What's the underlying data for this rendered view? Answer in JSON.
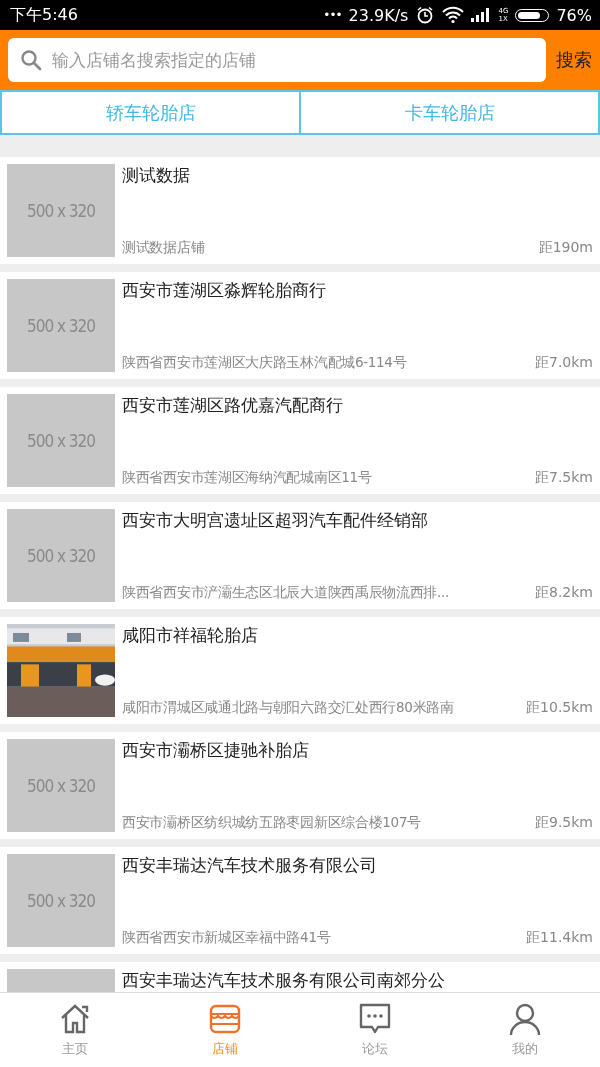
{
  "status_bar": {
    "time": "下午5:46",
    "dots": "•••",
    "speed": "23.9K/s",
    "network": "4G\n1X",
    "battery": "76%"
  },
  "search": {
    "placeholder": "输入店铺名搜索指定的店铺",
    "button": "搜索"
  },
  "tabs": [
    {
      "label": "轿车轮胎店"
    },
    {
      "label": "卡车轮胎店"
    }
  ],
  "shops": [
    {
      "image": {
        "kind": "placeholder",
        "text": "500 x 320"
      },
      "name": "测试数据",
      "address": "测试数据店铺",
      "distance": "距190m"
    },
    {
      "image": {
        "kind": "placeholder",
        "text": "500 x 320"
      },
      "name": "西安市莲湖区淼辉轮胎商行",
      "address": "陕西省西安市莲湖区大庆路玉林汽配城6-114号",
      "distance": "距7.0km"
    },
    {
      "image": {
        "kind": "placeholder",
        "text": "500 x 320"
      },
      "name": "西安市莲湖区路优嘉汽配商行",
      "address": "陕西省西安市莲湖区海纳汽配城南区11号",
      "distance": "距7.5km"
    },
    {
      "image": {
        "kind": "placeholder",
        "text": "500 x 320"
      },
      "name": "西安市大明宫遗址区超羽汽车配件经销部",
      "address": "陕西省西安市浐灞生态区北辰大道陕西禹辰物流西排...",
      "distance": "距8.2km"
    },
    {
      "name": "咸阳市祥福轮胎店",
      "address": "咸阳市渭城区咸通北路与朝阳六路交汇处西行80米路南",
      "distance": "距10.5km"
    },
    {
      "image": {
        "kind": "placeholder",
        "text": "500 x 320"
      },
      "name": "西安市灞桥区捷驰补胎店",
      "address": "西安市灞桥区纺织城纺五路枣园新区综合楼107号",
      "distance": "距9.5km"
    },
    {
      "image": {
        "kind": "placeholder",
        "text": "500 x 320"
      },
      "name": "西安丰瑞达汽车技术服务有限公司",
      "address": "陕西省西安市新城区幸福中路41号",
      "distance": "距11.4km"
    },
    {
      "image": {
        "kind": "placeholder"
      },
      "name": "西安丰瑞达汽车技术服务有限公司南郊分公"
    }
  ],
  "nav": [
    {
      "label": "主页",
      "kind": "home",
      "selected": false
    },
    {
      "label": "店铺",
      "kind": "store",
      "selected": true
    },
    {
      "label": "论坛",
      "kind": "chat",
      "selected": false
    },
    {
      "label": "我的",
      "kind": "user",
      "selected": false
    }
  ]
}
